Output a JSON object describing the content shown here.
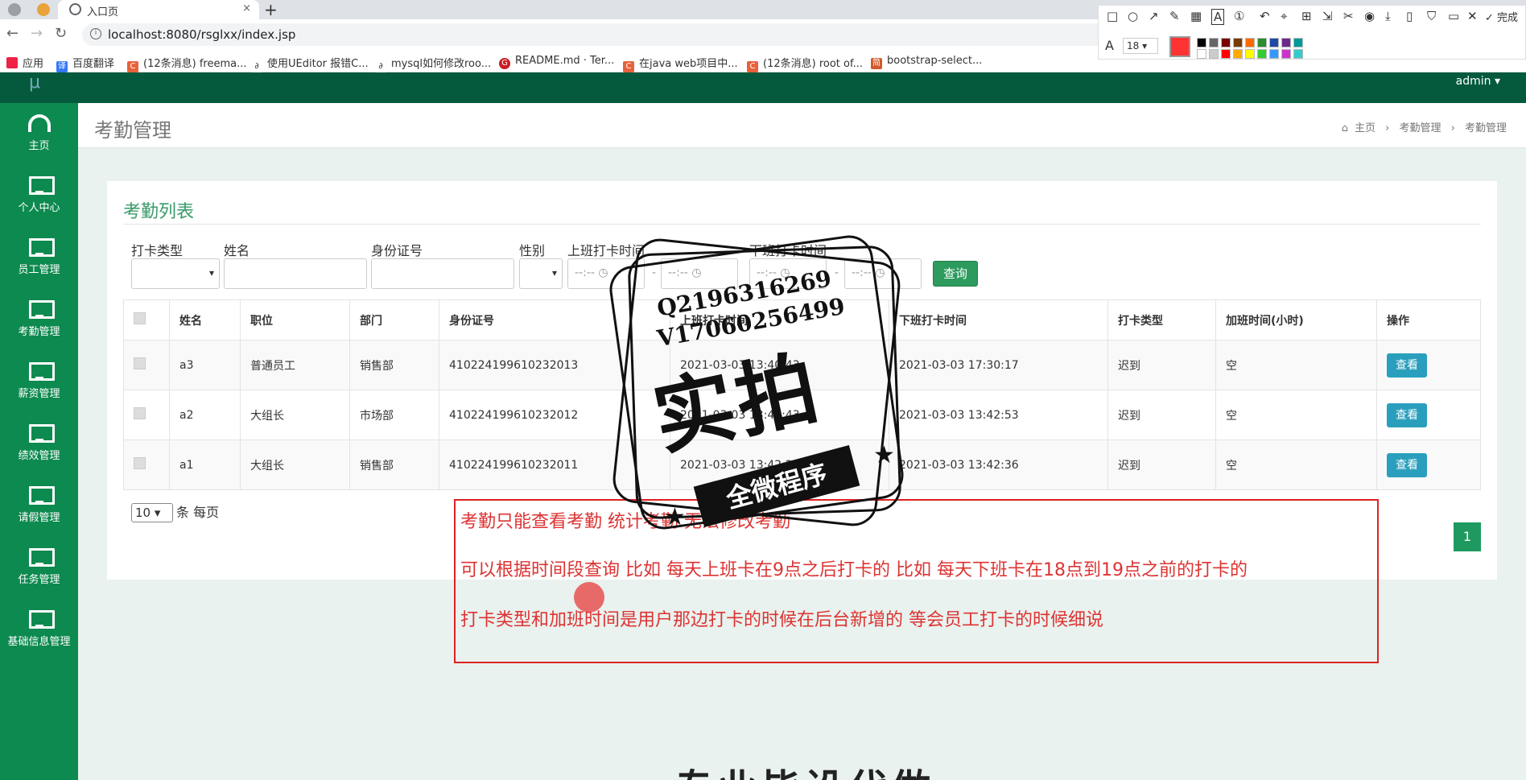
{
  "browser": {
    "tab_title": "入口页",
    "url": "localhost:8080/rsglxx/index.jsp",
    "bookmarks": [
      "应用",
      "百度翻译",
      "(12条消息) freema...",
      "使用UEditor 报错C...",
      "mysql如何修改roo...",
      "README.md · Ter...",
      "在java web项目中...",
      "(12条消息) root of...",
      "bootstrap-select..."
    ]
  },
  "screenshot_tool": {
    "font_size": "18",
    "done_label": "完成",
    "current_color": "#ff3333",
    "swatches": [
      "#000000",
      "#666666",
      "#7a0000",
      "#7a3a00",
      "#ff6a00",
      "#2e8b2e",
      "#1f4aa8",
      "#6a2a8a",
      "#009999",
      "#ffffff",
      "#cccccc",
      "#ff0000",
      "#ffaa00",
      "#ffff00",
      "#33cc33",
      "#3399ff",
      "#cc33cc",
      "#33cccc"
    ]
  },
  "header": {
    "user": "admin"
  },
  "sidebar": {
    "items": [
      {
        "label": "主页",
        "icon": "dashboard-icon"
      },
      {
        "label": "个人中心",
        "icon": "monitor-icon"
      },
      {
        "label": "员工管理",
        "icon": "monitor-icon"
      },
      {
        "label": "考勤管理",
        "icon": "monitor-icon"
      },
      {
        "label": "薪资管理",
        "icon": "monitor-icon"
      },
      {
        "label": "绩效管理",
        "icon": "monitor-icon"
      },
      {
        "label": "请假管理",
        "icon": "monitor-icon"
      },
      {
        "label": "任务管理",
        "icon": "monitor-icon"
      },
      {
        "label": "基础信息管理",
        "icon": "monitor-icon"
      }
    ]
  },
  "page": {
    "title": "考勤管理",
    "breadcrumb": [
      "主页",
      "考勤管理",
      "考勤管理"
    ]
  },
  "panel": {
    "title": "考勤列表",
    "filters": {
      "type_label": "打卡类型",
      "name_label": "姓名",
      "id_label": "身份证号",
      "gender_label": "性别",
      "checkin_label": "上班打卡时间",
      "checkout_label": "下班打卡时间",
      "time_placeholder": "--:--",
      "query_button": "查询"
    },
    "table": {
      "headers": [
        "姓名",
        "职位",
        "部门",
        "身份证号",
        "上班打卡时间",
        "下班打卡时间",
        "打卡类型",
        "加班时间(小时)",
        "操作"
      ],
      "rows": [
        {
          "name": "a3",
          "position": "普通员工",
          "dept": "销售部",
          "id": "410224199610232013",
          "checkin": "2021-03-03 13:40:43",
          "checkout": "2021-03-03 17:30:17",
          "type": "迟到",
          "overtime": "空",
          "action": "查看"
        },
        {
          "name": "a2",
          "position": "大组长",
          "dept": "市场部",
          "id": "410224199610232012",
          "checkin": "2021-03-03 13:42:43",
          "checkout": "2021-03-03 13:42:53",
          "type": "迟到",
          "overtime": "空",
          "action": "查看"
        },
        {
          "name": "a1",
          "position": "大组长",
          "dept": "销售部",
          "id": "410224199610232011",
          "checkin": "2021-03-03 13:42:26",
          "checkout": "2021-03-03 13:42:36",
          "type": "迟到",
          "overtime": "空",
          "action": "查看"
        }
      ]
    },
    "page_size": "10",
    "page_size_suffix": "条 每页",
    "current_page": "1"
  },
  "annotation": {
    "lines": [
      "考勤只能查看考勤 统计考勤 无法修改考勤",
      "可以根据时间段查询 比如 每天上班卡在9点之后打卡的 比如 每天下班卡在18点到19点之前的打卡的",
      "打卡类型和加班时间是用户那边打卡的时候在后台新增的   等会员工打卡的时候细说"
    ]
  },
  "watermark": {
    "line1": "Q2196316269",
    "line2": "V17060256499",
    "big": "实拍",
    "band": "全微程序"
  },
  "bottom_text": "专业毕设代做"
}
